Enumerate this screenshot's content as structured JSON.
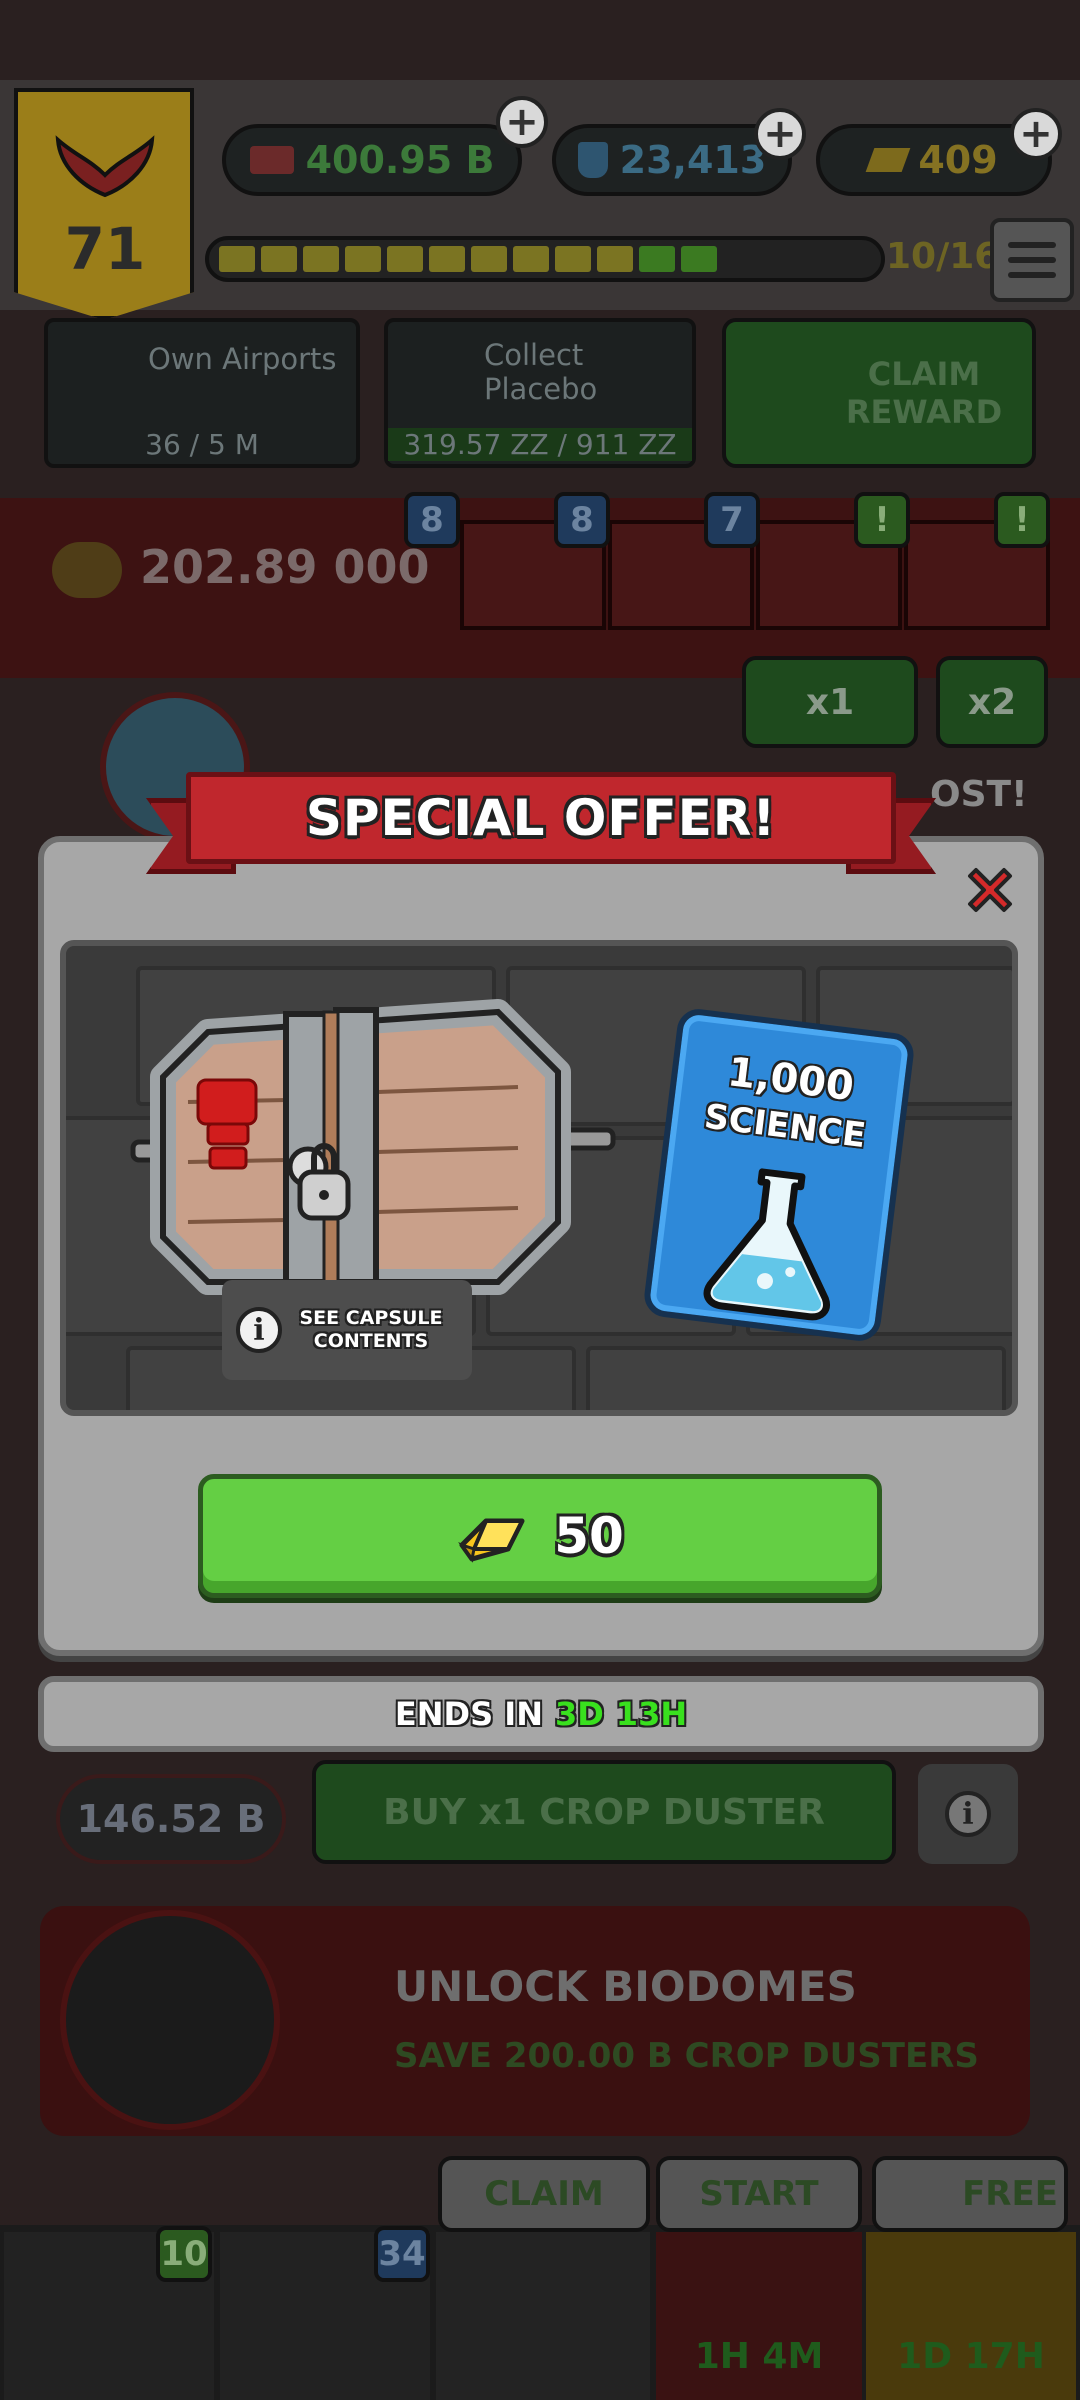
{
  "hud": {
    "level": "71",
    "cash": "400.95 B",
    "science": "23,413",
    "gold": "409",
    "progress": "10/16",
    "progress_fraction": 0.625
  },
  "goals": [
    {
      "title": "Own Airports",
      "progress": "36 / 5 M"
    },
    {
      "title": "Collect Placebo",
      "progress": "319.57 ZZ / 911 ZZ"
    }
  ],
  "claim_reward_label": "CLAIM REWARD",
  "resource_strip": {
    "amount": "202.89 000",
    "tab_badges": [
      "8",
      "8",
      "7",
      "!",
      "!"
    ]
  },
  "multipliers": [
    "x1",
    "x2"
  ],
  "boost_text": "OST!",
  "background_lower": {
    "price": "146.52 B",
    "buy_label": "BUY x1 CROP DUSTER",
    "unlock_title": "UNLOCK BIODOMES",
    "unlock_sub": "SAVE 200.00 B CROP DUSTERS",
    "bottom_labels": [
      "CLAIM",
      "START",
      "FREE"
    ],
    "bottom_badges": [
      "10",
      "34"
    ],
    "bottom_timers": [
      "1H 4M",
      "1D 17H"
    ]
  },
  "offer": {
    "title": "SPECIAL OFFER!",
    "see_contents": "SEE CAPSULE CONTENTS",
    "card_amount": "1,000",
    "card_label": "SCIENCE",
    "price": "50",
    "ends_prefix": "ENDS IN",
    "ends_days": "3D",
    "ends_hours": "13H"
  },
  "colors": {
    "ribbon": "#c0272d",
    "buy_button": "#64cf44",
    "timer_green": "#39e01e",
    "science_card": "#2e89d9",
    "close_red": "#d42a2a"
  }
}
